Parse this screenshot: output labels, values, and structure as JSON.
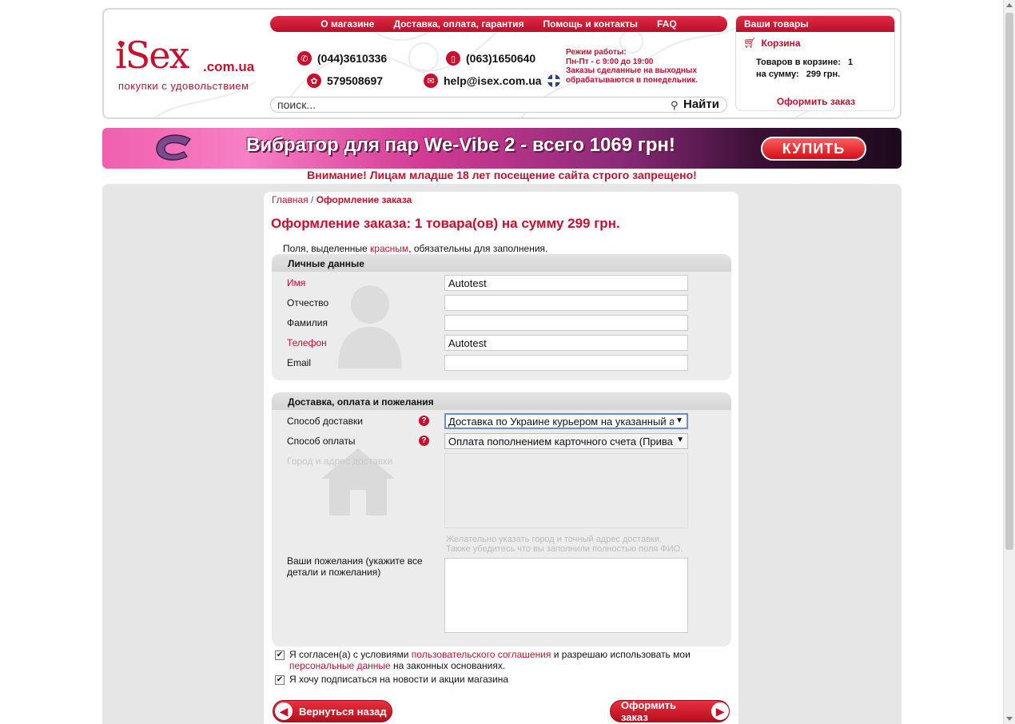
{
  "logo": {
    "brand": "iSex",
    "domain": ".com.ua",
    "tagline": "покупки с удовольствием"
  },
  "topnav": [
    "О магазине",
    "Доставка, оплата, гарантия",
    "Помощь и контакты",
    "FAQ"
  ],
  "contacts": {
    "phone1": "(044)3610336",
    "phone2": "(063)1650640",
    "icq": "579508697",
    "email": "help@isex.com.ua"
  },
  "hours": {
    "line1": "Режим работы:",
    "line2": "Пн-Пт - с 9:00 до 19:00",
    "line3": "Заказы сделанные на выходных",
    "line4": "обрабатываются в понедельник."
  },
  "search": {
    "placeholder": "поиск...",
    "value": "поиск...",
    "button": "Найти"
  },
  "cart": {
    "title": "Ваши товары",
    "link": "Корзина",
    "items_label": "Товаров в корзине:",
    "items_value": "1",
    "sum_label": "на сумму:",
    "sum_value": "299 грн.",
    "order_link": "Оформить заказ"
  },
  "banner": {
    "text": "Вибратор для пар We-Vibe 2 - всего 1069 грн!",
    "button": "КУПИТЬ"
  },
  "warning": "Внимание! Лицам младше 18 лет посещение сайта строго запрещено!",
  "breadcrumb": {
    "home": "Главная",
    "sep": "/",
    "current": "Оформление заказа"
  },
  "page_title": "Оформление заказа: 1 товара(ов) на сумму 299 грн.",
  "required_note": {
    "before": "Поля, выделенные ",
    "red": "красным",
    "after": ", обязательны для заполнения."
  },
  "personal": {
    "title": "Личные данные",
    "fields": [
      {
        "label": "Имя",
        "value": "Autotest"
      },
      {
        "label": "Отчество",
        "value": ""
      },
      {
        "label": "Фамилия",
        "value": ""
      },
      {
        "label": "Телефон",
        "value": "Autotest"
      },
      {
        "label": "Email",
        "value": ""
      }
    ]
  },
  "delivery": {
    "title": "Доставка, оплата и пожелания",
    "method_label": "Способ доставки",
    "method_value": "Доставка по Украине курьером на указанный а",
    "payment_label": "Способ оплаты",
    "payment_value": "Оплата пополнением карточного счета (Прива",
    "address_label": "Город и адрес доставки",
    "address_hint1": "Желательно указать город и точный адрес доставки.",
    "address_hint2": "Также убедитесь что вы заполнили полностью поля ФИО.",
    "wishes_label": "Ваши пожелания (укажите все детали и пожелания)",
    "help_icon": "?"
  },
  "agreements": {
    "terms_before": "Я согласен(а) с условиями ",
    "terms_link": "пользовательского соглашения",
    "terms_mid": " и разрешаю использовать мои",
    "terms_link2": "персональные данные",
    "terms_after": " на законных основаниях.",
    "subscribe": "Я хочу подписаться на новости и акции магазина",
    "check_mark": "✔"
  },
  "buttons": {
    "back": "Вернуться назад",
    "submit": "Оформить заказ"
  },
  "colors": {
    "brand_red": "#c8102e",
    "panel_bg": "#ececec",
    "page_bg": "#e6e6e6"
  }
}
